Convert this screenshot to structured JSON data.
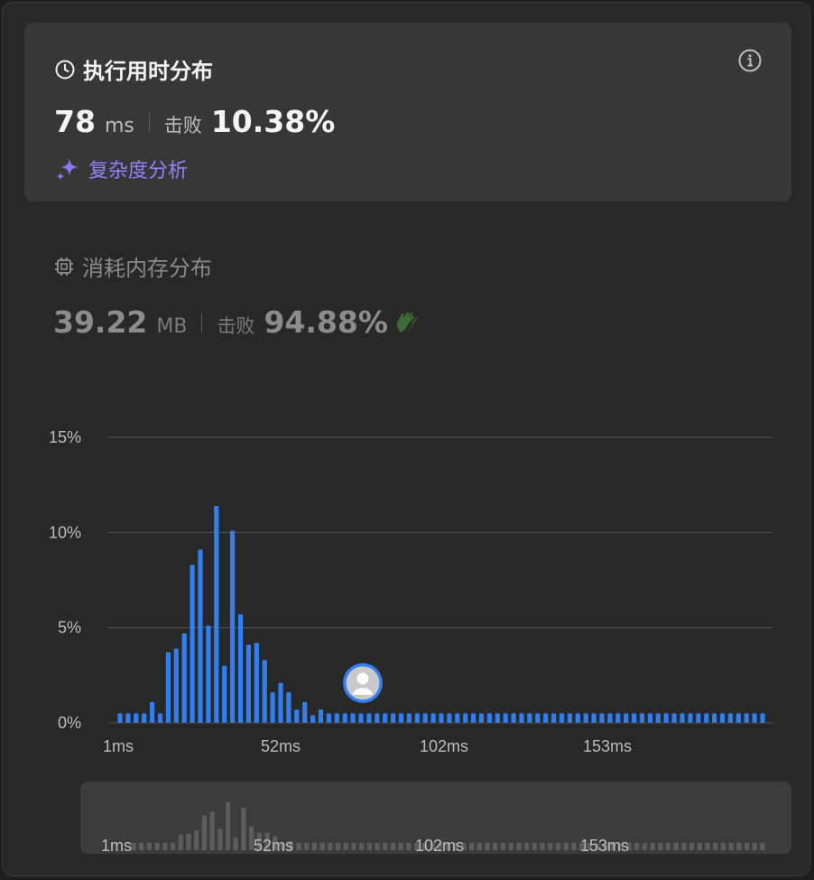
{
  "runtime": {
    "title": "执行用时分布",
    "value": "78",
    "unit": "ms",
    "beat_label": "击败",
    "beat_value": "10.38%",
    "complexity_label": "复杂度分析"
  },
  "memory": {
    "title": "消耗内存分布",
    "value": "39.22",
    "unit": "MB",
    "beat_label": "击败",
    "beat_value": "94.88%"
  },
  "colors": {
    "bar": "#2f7ff0",
    "mini_bar": "#5c5c5c",
    "accent_purple": "#8d83ff",
    "grid": "#555555"
  },
  "chart_data": {
    "type": "bar",
    "ylim": [
      0,
      15
    ],
    "y_ticks": [
      "0%",
      "5%",
      "10%",
      "15%"
    ],
    "x_ticks": [
      "1ms",
      "52ms",
      "102ms",
      "153ms"
    ],
    "marker_bin": 30,
    "marker_icon": "user-avatar-icon",
    "values": [
      0.5,
      0.5,
      0.5,
      0.5,
      1.1,
      0.5,
      3.7,
      3.9,
      4.7,
      8.3,
      9.1,
      5.1,
      11.4,
      3.0,
      10.1,
      5.7,
      4.1,
      4.2,
      3.3,
      1.6,
      2.1,
      1.6,
      0.7,
      1.1,
      0.4,
      0.7,
      0.5,
      0.5,
      0.5,
      0.5,
      0.5,
      0.5,
      0.5,
      0.5,
      0.5,
      0.5,
      0.5,
      0.5,
      0.5,
      0.5,
      0.5,
      0.5,
      0.5,
      0.5,
      0.5,
      0.5,
      0.5,
      0.5,
      0.5,
      0.5,
      0.5,
      0.5,
      0.5,
      0.5,
      0.5,
      0.5,
      0.5,
      0.5,
      0.5,
      0.5,
      0.5,
      0.5,
      0.5,
      0.5,
      0.5,
      0.5,
      0.5,
      0.5,
      0.5,
      0.5,
      0.5,
      0.5,
      0.5,
      0.5,
      0.5,
      0.5,
      0.5,
      0.5,
      0.5,
      0.5,
      0.5
    ],
    "minimap_x_ticks": [
      "1ms",
      "52ms",
      "102ms",
      "153ms"
    ]
  }
}
